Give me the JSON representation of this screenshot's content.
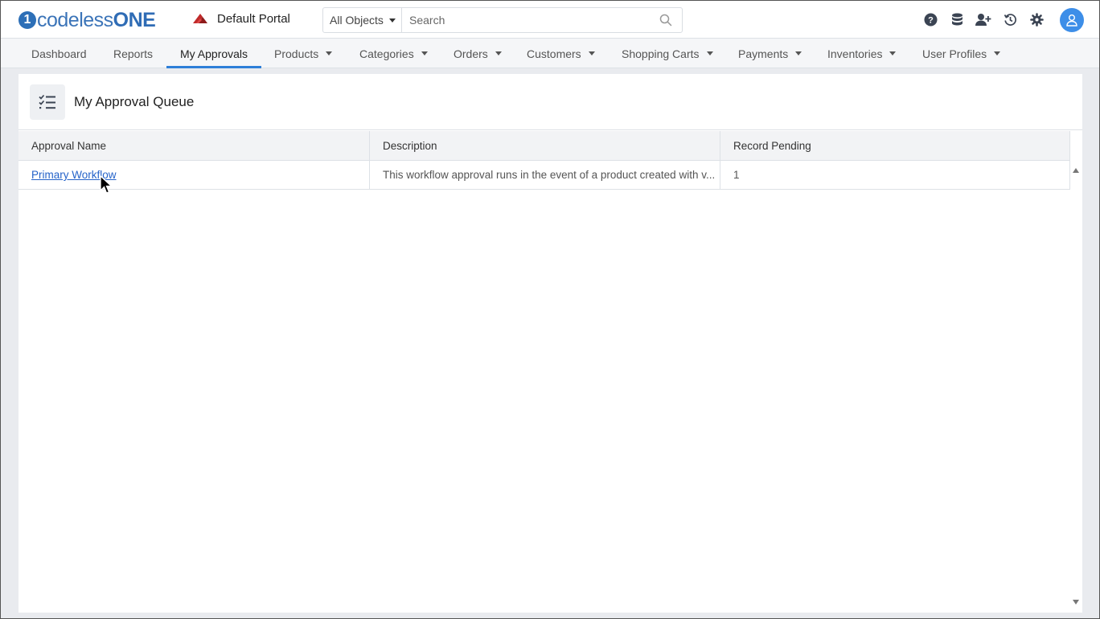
{
  "brand": {
    "logo_mark": "1",
    "logo_text_a": "codeless",
    "logo_text_b": "ONE"
  },
  "portal": {
    "name": "Default Portal"
  },
  "search": {
    "scope": "All Objects",
    "placeholder": "Search"
  },
  "top_icons": [
    "help-icon",
    "database-icon",
    "add-user-icon",
    "history-icon",
    "gear-icon",
    "avatar"
  ],
  "nav": {
    "tabs": [
      {
        "label": "Dashboard",
        "dropdown": false
      },
      {
        "label": "Reports",
        "dropdown": false
      },
      {
        "label": "My Approvals",
        "dropdown": false,
        "active": true
      },
      {
        "label": "Products",
        "dropdown": true
      },
      {
        "label": "Categories",
        "dropdown": true
      },
      {
        "label": "Orders",
        "dropdown": true
      },
      {
        "label": "Customers",
        "dropdown": true
      },
      {
        "label": "Shopping Carts",
        "dropdown": true
      },
      {
        "label": "Payments",
        "dropdown": true
      },
      {
        "label": "Inventories",
        "dropdown": true
      },
      {
        "label": "User Profiles",
        "dropdown": true
      }
    ]
  },
  "panel": {
    "title": "My Approval Queue"
  },
  "grid": {
    "columns": [
      "Approval Name",
      "Description",
      "Record Pending"
    ],
    "rows": [
      {
        "name": "Primary Workflow",
        "description": "This workflow approval runs in the event of a product created with v...",
        "pending": "1"
      }
    ]
  },
  "colors": {
    "accent": "#2d7fd8",
    "link": "#2563c9",
    "brand": "#2d6fb7",
    "avatar": "#3d8ee8"
  }
}
